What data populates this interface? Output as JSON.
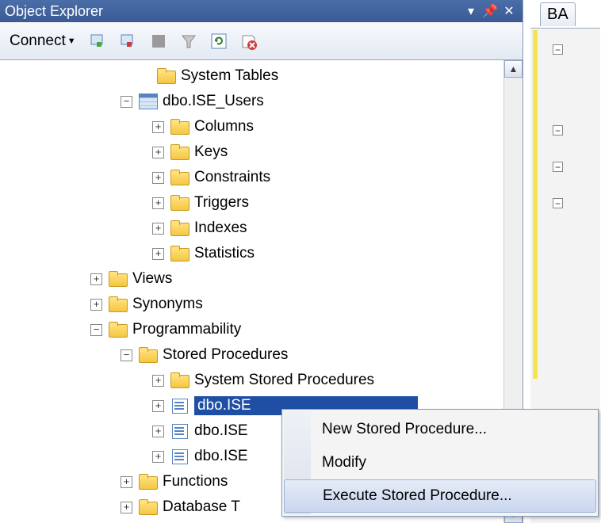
{
  "titlebar": {
    "title": "Object Explorer"
  },
  "toolbar": {
    "connect_label": "Connect"
  },
  "tree": {
    "system_tables": "System Tables",
    "ise_users": "dbo.ISE_Users",
    "columns": "Columns",
    "keys": "Keys",
    "constraints": "Constraints",
    "triggers": "Triggers",
    "indexes": "Indexes",
    "statistics": "Statistics",
    "views": "Views",
    "synonyms": "Synonyms",
    "programmability": "Programmability",
    "stored_procs": "Stored Procedures",
    "sys_stored_procs": "System Stored Procedures",
    "proc1": "dbo.ISE",
    "proc2": "dbo.ISE",
    "proc3": "dbo.ISE",
    "functions": "Functions",
    "db_triggers": "Database T"
  },
  "context_menu": {
    "new_proc": "New Stored Procedure...",
    "modify": "Modify",
    "execute": "Execute Stored Procedure..."
  },
  "right_tab": {
    "label": "BA"
  }
}
